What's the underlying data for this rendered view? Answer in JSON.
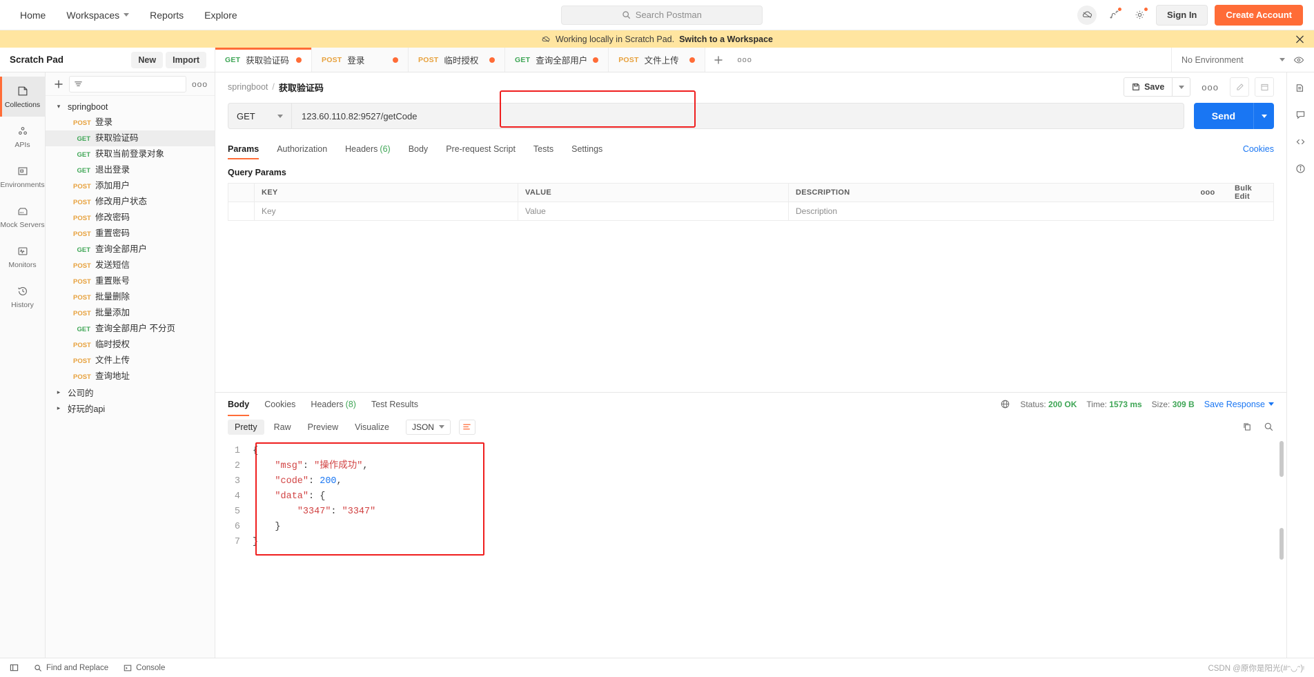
{
  "topnav": {
    "items": [
      {
        "label": "Home",
        "caret": false
      },
      {
        "label": "Workspaces",
        "caret": true
      },
      {
        "label": "Reports",
        "caret": false
      },
      {
        "label": "Explore",
        "caret": false
      }
    ],
    "search_placeholder": "Search Postman",
    "sign_in": "Sign In",
    "create_account": "Create Account"
  },
  "banner": {
    "text": "Working locally in Scratch Pad.",
    "link": "Switch to a Workspace"
  },
  "scratchpad": {
    "title": "Scratch Pad",
    "new_label": "New",
    "import_label": "Import"
  },
  "tabs": [
    {
      "method": "GET",
      "name": "获取验证码",
      "active": true,
      "unsaved": true
    },
    {
      "method": "POST",
      "name": "登录",
      "active": false,
      "unsaved": true
    },
    {
      "method": "POST",
      "name": "临时授权",
      "active": false,
      "unsaved": true
    },
    {
      "method": "GET",
      "name": "查询全部用户",
      "active": false,
      "unsaved": true
    },
    {
      "method": "POST",
      "name": "文件上传",
      "active": false,
      "unsaved": true
    }
  ],
  "environment": {
    "selected": "No Environment"
  },
  "rail": [
    {
      "label": "Collections",
      "icon": "collections-icon",
      "active": true
    },
    {
      "label": "APIs",
      "icon": "apis-icon",
      "active": false
    },
    {
      "label": "Environments",
      "icon": "environments-icon",
      "active": false
    },
    {
      "label": "Mock Servers",
      "icon": "mock-servers-icon",
      "active": false
    },
    {
      "label": "Monitors",
      "icon": "monitors-icon",
      "active": false
    },
    {
      "label": "History",
      "icon": "history-icon",
      "active": false
    }
  ],
  "sidebar": {
    "tree": [
      {
        "type": "folder",
        "name": "springboot",
        "expanded": true
      },
      {
        "type": "request",
        "method": "POST",
        "name": "登录",
        "selected": false
      },
      {
        "type": "request",
        "method": "GET",
        "name": "获取验证码",
        "selected": true
      },
      {
        "type": "request",
        "method": "GET",
        "name": "获取当前登录对象",
        "selected": false
      },
      {
        "type": "request",
        "method": "GET",
        "name": "退出登录",
        "selected": false
      },
      {
        "type": "request",
        "method": "POST",
        "name": "添加用户",
        "selected": false
      },
      {
        "type": "request",
        "method": "POST",
        "name": "修改用户状态",
        "selected": false
      },
      {
        "type": "request",
        "method": "POST",
        "name": "修改密码",
        "selected": false
      },
      {
        "type": "request",
        "method": "POST",
        "name": "重置密码",
        "selected": false
      },
      {
        "type": "request",
        "method": "GET",
        "name": "查询全部用户",
        "selected": false
      },
      {
        "type": "request",
        "method": "POST",
        "name": "发送短信",
        "selected": false
      },
      {
        "type": "request",
        "method": "POST",
        "name": "重置账号",
        "selected": false
      },
      {
        "type": "request",
        "method": "POST",
        "name": "批量删除",
        "selected": false
      },
      {
        "type": "request",
        "method": "POST",
        "name": "批量添加",
        "selected": false
      },
      {
        "type": "request",
        "method": "GET",
        "name": "查询全部用户 不分页",
        "selected": false
      },
      {
        "type": "request",
        "method": "POST",
        "name": "临时授权",
        "selected": false
      },
      {
        "type": "request",
        "method": "POST",
        "name": "文件上传",
        "selected": false
      },
      {
        "type": "request",
        "method": "POST",
        "name": "查询地址",
        "selected": false
      },
      {
        "type": "folder",
        "name": "公司的",
        "expanded": false
      },
      {
        "type": "folder",
        "name": "好玩的api",
        "expanded": false
      }
    ]
  },
  "request": {
    "breadcrumb_collection": "springboot",
    "breadcrumb_name": "获取验证码",
    "save_label": "Save",
    "method": "GET",
    "url": "123.60.110.82:9527/getCode",
    "send_label": "Send",
    "tabs": [
      {
        "label": "Params",
        "count": "",
        "active": true
      },
      {
        "label": "Authorization",
        "count": "",
        "active": false
      },
      {
        "label": "Headers",
        "count": "(6)",
        "active": false
      },
      {
        "label": "Body",
        "count": "",
        "active": false
      },
      {
        "label": "Pre-request Script",
        "count": "",
        "active": false
      },
      {
        "label": "Tests",
        "count": "",
        "active": false
      },
      {
        "label": "Settings",
        "count": "",
        "active": false
      }
    ],
    "cookies_link": "Cookies",
    "query_params_title": "Query Params",
    "params_table": {
      "headers": [
        "KEY",
        "VALUE",
        "DESCRIPTION"
      ],
      "bulk_edit": "Bulk Edit",
      "row_placeholders": [
        "Key",
        "Value",
        "Description"
      ]
    }
  },
  "response": {
    "tabs": [
      {
        "label": "Body",
        "count": "",
        "active": true
      },
      {
        "label": "Cookies",
        "count": "",
        "active": false
      },
      {
        "label": "Headers",
        "count": "(8)",
        "active": false
      },
      {
        "label": "Test Results",
        "count": "",
        "active": false
      }
    ],
    "status_label": "Status:",
    "status_value": "200 OK",
    "time_label": "Time:",
    "time_value": "1573 ms",
    "size_label": "Size:",
    "size_value": "309 B",
    "save_response": "Save Response",
    "view_modes": [
      {
        "label": "Pretty",
        "active": true
      },
      {
        "label": "Raw",
        "active": false
      },
      {
        "label": "Preview",
        "active": false
      },
      {
        "label": "Visualize",
        "active": false
      }
    ],
    "format": "JSON",
    "body_lines": [
      {
        "n": "1",
        "indent": 0,
        "parts": [
          {
            "t": "{",
            "c": "punc"
          }
        ]
      },
      {
        "n": "2",
        "indent": 1,
        "parts": [
          {
            "t": "\"msg\"",
            "c": "str"
          },
          {
            "t": ": ",
            "c": "punc"
          },
          {
            "t": "\"操作成功\"",
            "c": "str"
          },
          {
            "t": ",",
            "c": "punc"
          }
        ]
      },
      {
        "n": "3",
        "indent": 1,
        "parts": [
          {
            "t": "\"code\"",
            "c": "str"
          },
          {
            "t": ": ",
            "c": "punc"
          },
          {
            "t": "200",
            "c": "num"
          },
          {
            "t": ",",
            "c": "punc"
          }
        ]
      },
      {
        "n": "4",
        "indent": 1,
        "parts": [
          {
            "t": "\"data\"",
            "c": "str"
          },
          {
            "t": ": ",
            "c": "punc"
          },
          {
            "t": "{",
            "c": "punc"
          }
        ]
      },
      {
        "n": "5",
        "indent": 2,
        "parts": [
          {
            "t": "\"3347\"",
            "c": "str"
          },
          {
            "t": ": ",
            "c": "punc"
          },
          {
            "t": "\"3347\"",
            "c": "str"
          }
        ]
      },
      {
        "n": "6",
        "indent": 1,
        "parts": [
          {
            "t": "}",
            "c": "punc"
          }
        ]
      },
      {
        "n": "7",
        "indent": 0,
        "parts": [
          {
            "t": "}",
            "c": "punc"
          }
        ]
      }
    ]
  },
  "footer": {
    "find_replace": "Find and Replace",
    "console": "Console",
    "watermark": "CSDN @原你是阳光(#ᵔ◡ᵔ)ᵎ"
  }
}
